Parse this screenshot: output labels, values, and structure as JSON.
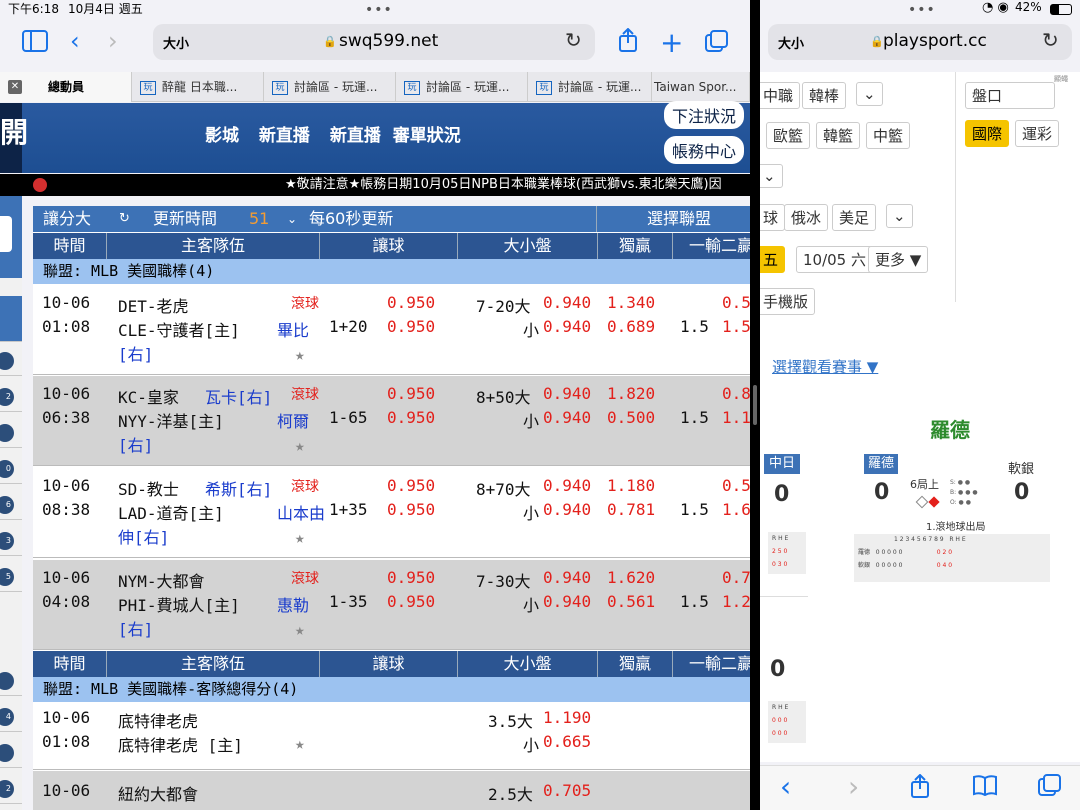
{
  "status": {
    "time": "下午6:18",
    "date": "10月4日 週五",
    "battery": "42%"
  },
  "left_browser": {
    "aa": "大小",
    "domain": "swq599.net",
    "tabs": [
      {
        "label": "總動員"
      },
      {
        "label": "醉龍 日本職..."
      },
      {
        "label": "討論區 - 玩運..."
      },
      {
        "label": "討論區 - 玩運..."
      },
      {
        "label": "討論區 - 玩運..."
      },
      {
        "label": "Taiwan Spor..."
      }
    ]
  },
  "site": {
    "logo": "開",
    "nav": [
      "影城",
      "新直播",
      "新直播",
      "審單狀況"
    ],
    "btn_status": "下注狀況",
    "btn_account": "帳務中心",
    "ticker": "★敬請注意★帳務日期10月05日NPB日本職業棒球(西武獅vs.東北樂天鷹)因"
  },
  "toolbar": {
    "mode": "讓分大",
    "refresh_label": "更新時間",
    "refresh_count": "51",
    "refresh_interval": "每60秒更新",
    "select_league": "選擇聯盟"
  },
  "columns": {
    "time": "時間",
    "teams": "主客隊伍",
    "handicap": "讓球",
    "ou": "大小盤",
    "ml": "獨贏",
    "oneloss": "一輸二贏"
  },
  "league1": "聯盟: MLB 美國職棒(4)",
  "games": [
    {
      "date": "10-06",
      "time": "01:08",
      "away": "DET-老虎",
      "home": "CLE-守護者[主]",
      "away_p": "",
      "home_p": "畢比",
      "home_p2": "[右]",
      "live": "滾球",
      "hc_line": "1+20",
      "hc1": "0.950",
      "hc2": "0.950",
      "ou_line": "7-20大",
      "ou1": "0.940",
      "ou_small": "小",
      "ou2": "0.940",
      "ml1": "1.340",
      "ml2": "0.689",
      "ol_line": "1.5",
      "ol1": "0.5",
      "ol2": "1.5"
    },
    {
      "date": "10-06",
      "time": "06:38",
      "away": "KC-皇家",
      "home": "NYY-洋基[主]",
      "away_p": "瓦卡[右]",
      "home_p": "柯爾",
      "home_p2": "[右]",
      "live": "滾球",
      "hc_line": "1-65",
      "hc1": "0.950",
      "hc2": "0.950",
      "ou_line": "8+50大",
      "ou1": "0.940",
      "ou_small": "小",
      "ou2": "0.940",
      "ml1": "1.820",
      "ml2": "0.500",
      "ol_line": "1.5",
      "ol1": "0.8",
      "ol2": "1.1"
    },
    {
      "date": "10-06",
      "time": "08:38",
      "away": "SD-教士",
      "home": "LAD-道奇[主]",
      "away_p": "希斯[右]",
      "home_p": "山本由",
      "home_p2": "伸[右]",
      "live": "滾球",
      "hc_line": "1+35",
      "hc1": "0.950",
      "hc2": "0.950",
      "ou_line": "8+70大",
      "ou1": "0.940",
      "ou_small": "小",
      "ou2": "0.940",
      "ml1": "1.180",
      "ml2": "0.781",
      "ol_line": "1.5",
      "ol1": "0.5",
      "ol2": "1.6"
    },
    {
      "date": "10-06",
      "time": "04:08",
      "away": "NYM-大都會",
      "home": "PHI-費城人[主]",
      "away_p": "",
      "home_p": "惠勒",
      "home_p2": "[右]",
      "live": "滾球",
      "hc_line": "1-35",
      "hc1": "0.950",
      "hc2": "0.950",
      "ou_line": "7-30大",
      "ou1": "0.940",
      "ou_small": "小",
      "ou2": "0.940",
      "ml1": "1.620",
      "ml2": "0.561",
      "ol_line": "1.5",
      "ol1": "0.7",
      "ol2": "1.2"
    }
  ],
  "league2": "聯盟: MLB 美國職棒-客隊總得分(4)",
  "games2": [
    {
      "date": "10-06",
      "time": "01:08",
      "away": "底特律老虎",
      "home": "底特律老虎 [主]",
      "ou_line": "3.5大",
      "ou1": "1.190",
      "ou_small": "小",
      "ou2": "0.665"
    },
    {
      "date": "10-06",
      "time": "",
      "away": "紐約大都會",
      "home": "",
      "ou_line": "2.5大",
      "ou1": "0.705",
      "ou_small": "",
      "ou2": ""
    }
  ],
  "right_browser": {
    "aa": "大小",
    "domain": "playsport.cc",
    "tags_row0": [
      "中職",
      "韓棒"
    ],
    "tags_row1": [
      "歐籃",
      "韓籃",
      "中籃"
    ],
    "tags_row2": [
      "球",
      "俄冰",
      "美足"
    ],
    "odds_tab": "盤口",
    "intl": "國際",
    "lottery": "運彩",
    "date_sel": "五",
    "date_next": "10/05 六",
    "more": "更多 ▼",
    "mobile": "手機版",
    "choose": "選擇觀看賽事 ▼",
    "tiny_tag": "顯蠅",
    "game": {
      "title": "羅德",
      "team_left": "中日",
      "team_mid": "羅德",
      "team_right": "軟銀",
      "score_left": "0",
      "score_mid": "0",
      "score_right": "0",
      "inning": "6局上",
      "result": "1.滾地球出局",
      "score_low": "0"
    }
  }
}
